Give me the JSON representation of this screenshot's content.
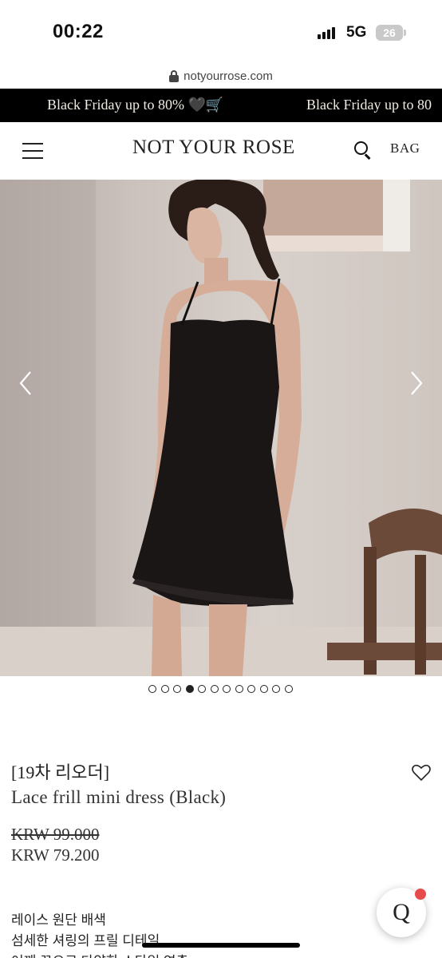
{
  "status_bar": {
    "time": "00:22",
    "network": "5G",
    "battery": "26"
  },
  "url_bar": {
    "url": "notyourrose.com"
  },
  "promo": {
    "text": "Black Friday up to 80% 🖤🛒",
    "text_repeat": "Black Friday up to 80"
  },
  "header": {
    "logo": "NOT YOUR ROSE",
    "bag_label": "BAG"
  },
  "gallery": {
    "total_images": 12,
    "active_index": 3
  },
  "product": {
    "tag": "[19차 리오더]",
    "name": "Lace frill mini dress (Black)",
    "price_original": "KRW 99.000",
    "price_sale": "KRW 79.200"
  },
  "description": {
    "line1": "레이스 원단 배색",
    "line2": "섬세한 셔링의 프릴 디테일",
    "line3": "어깨 끈으로 다양한 스타일 연출"
  },
  "chat": {
    "label": "Q"
  },
  "colors": {
    "promo_bg": "#000000",
    "badge": "#e74c4c"
  }
}
